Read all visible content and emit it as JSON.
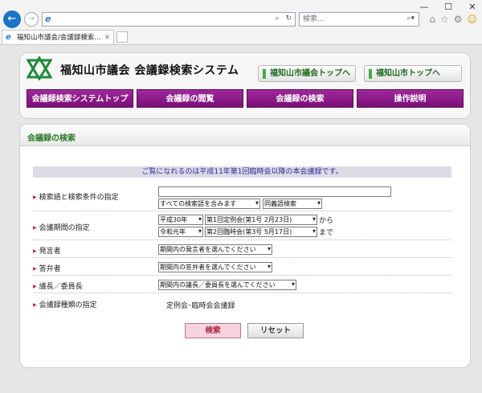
{
  "browser": {
    "search_placeholder": "検索...",
    "tab_title": "福知山市議会/会議録検索...",
    "tab_close": "×",
    "window_controls": [
      "—",
      "☐",
      "✕"
    ]
  },
  "header": {
    "title": "福知山市議会 会議録検索システム",
    "link_assembly": "福知山市議会トップへ",
    "link_city": "福知山市トップへ",
    "nav": [
      "会議録検索システムトップ",
      "会議録の閲覧",
      "会議録の検索",
      "操作説明"
    ]
  },
  "section": {
    "title": "会議録の検索",
    "notice": "ご覧になれるのは平成11年第1回臨時会以降の本会議録です。"
  },
  "form": {
    "keyword_label": "検索語と検索条件の指定",
    "keyword_value": "",
    "condition_selected": "すべての検索語を含みます",
    "synonym_selected": "同義語検索",
    "period_label": "会議期間の指定",
    "from_era": "平成30年",
    "from_session": "第1回定例会(第1号 2月23日)",
    "from_suffix": "から",
    "to_era": "令和元年",
    "to_session": "第2回臨時会(第3号 5月17日)",
    "to_suffix": "まで",
    "speaker_label": "発言者",
    "speaker_selected": "期間内の発言者を選んでください",
    "answerer_label": "答弁者",
    "answerer_selected": "期間内の答弁者を選んでください",
    "chair_label": "議長／委員長",
    "chair_selected": "期間内の議長／委員長を選んでください",
    "type_label": "会議録種類の指定",
    "type_value": "定例会･臨時会会議録",
    "search_button": "検索",
    "reset_button": "リセット"
  },
  "colors": {
    "nav_purple": "#7a0f78",
    "link_green": "#1f6a1f",
    "section_green": "#2a7a2a",
    "notice_blue": "#2a2a9a"
  }
}
